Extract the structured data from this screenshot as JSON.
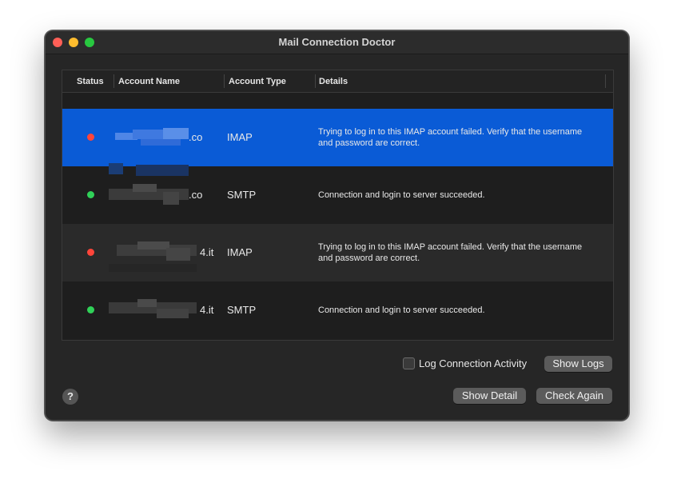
{
  "window": {
    "title": "Mail Connection Doctor"
  },
  "table": {
    "headers": {
      "status": "Status",
      "account_name": "Account Name",
      "account_type": "Account Type",
      "details": "Details"
    },
    "rows": [
      {
        "status": "error",
        "status_color": "#ff453a",
        "account_suffix": ".co",
        "account_type": "IMAP",
        "details": "Trying to log in to this IMAP account failed. Verify that the username and password are correct."
      },
      {
        "status": "ok",
        "status_color": "#30d158",
        "account_suffix": ".co",
        "account_type": "SMTP",
        "details": "Connection and login to server succeeded."
      },
      {
        "status": "error",
        "status_color": "#ff453a",
        "account_suffix": "4.it",
        "account_type": "IMAP",
        "details": "Trying to log in to this IMAP account failed. Verify that the username and password are correct."
      },
      {
        "status": "ok",
        "status_color": "#30d158",
        "account_suffix": "4.it",
        "account_type": "SMTP",
        "details": "Connection and login to server succeeded."
      }
    ]
  },
  "controls": {
    "log_connection_activity_label": "Log Connection Activity",
    "log_connection_activity_checked": false,
    "show_logs_label": "Show Logs",
    "show_detail_label": "Show Detail",
    "check_again_label": "Check Again",
    "help_label": "?"
  },
  "colors": {
    "selection": "#0a5bd6",
    "window_bg": "#262626"
  }
}
